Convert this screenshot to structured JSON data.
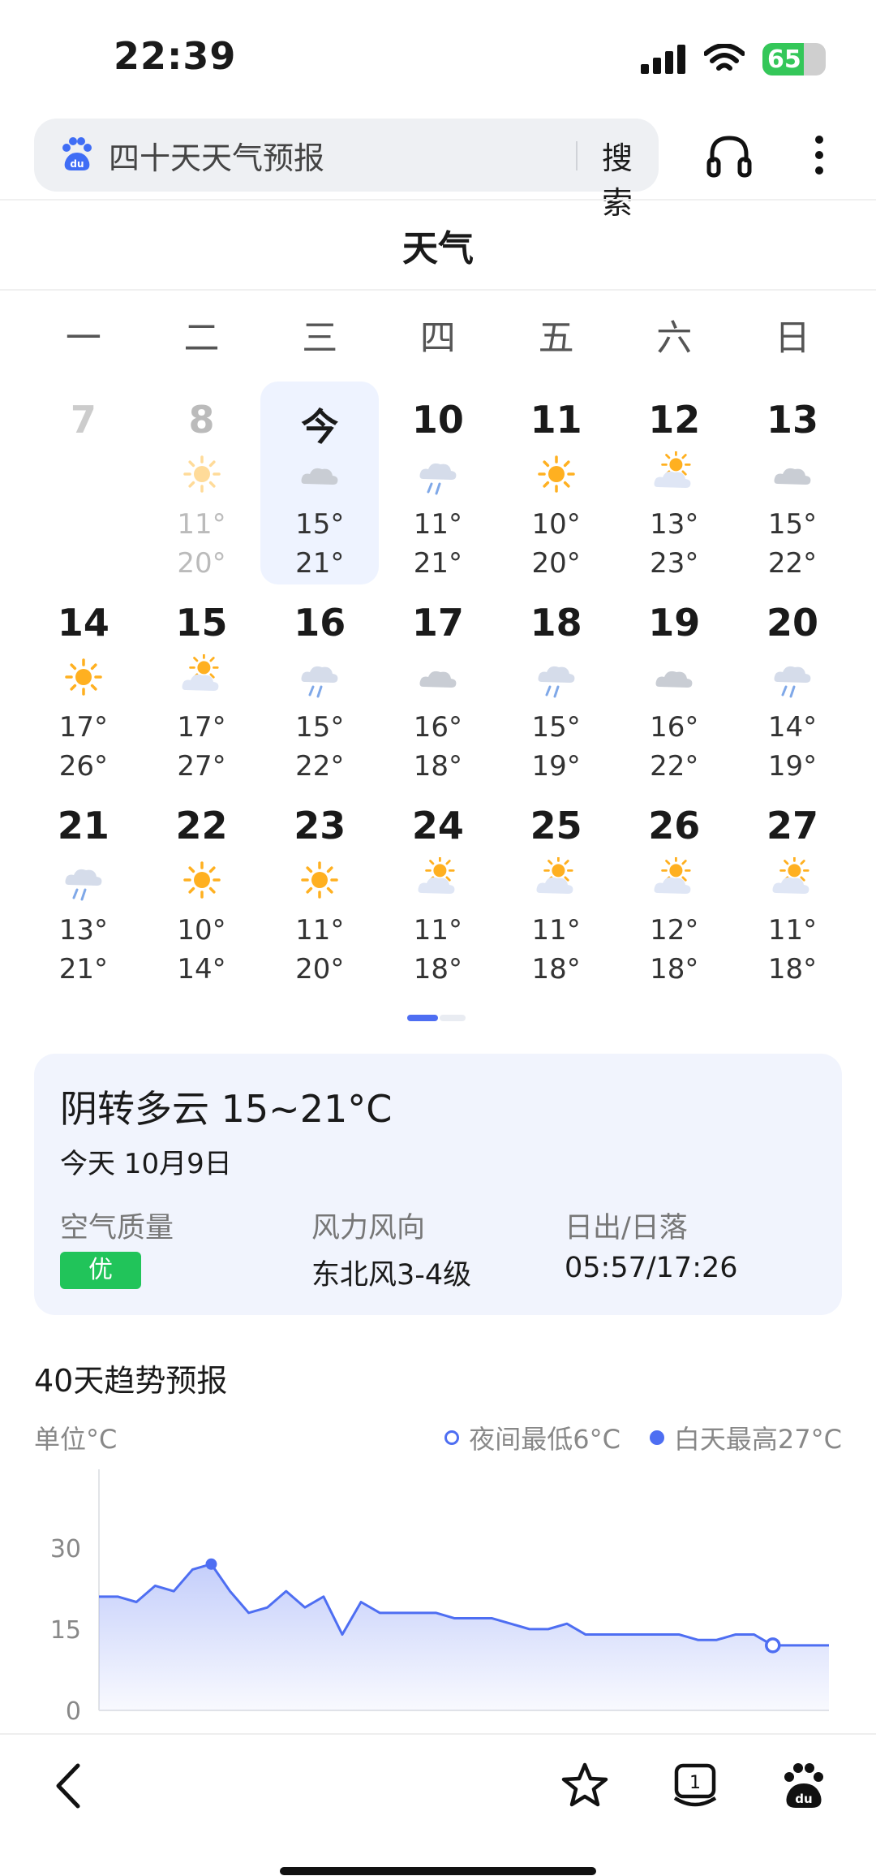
{
  "status": {
    "time": "22:39",
    "battery": "65"
  },
  "search": {
    "query": "四十天天气预报",
    "button": "搜索"
  },
  "page_title": "天气",
  "weekdays": [
    "一",
    "二",
    "三",
    "四",
    "五",
    "六",
    "日"
  ],
  "calendar": [
    {
      "day": "7",
      "icon": "",
      "low": "",
      "high": "",
      "state": "faded"
    },
    {
      "day": "8",
      "icon": "sun",
      "low": "11°",
      "high": "20°",
      "state": "past"
    },
    {
      "day": "今",
      "icon": "cloud",
      "low": "15°",
      "high": "21°",
      "state": "today"
    },
    {
      "day": "10",
      "icon": "rain",
      "low": "11°",
      "high": "21°",
      "state": ""
    },
    {
      "day": "11",
      "icon": "sun",
      "low": "10°",
      "high": "20°",
      "state": ""
    },
    {
      "day": "12",
      "icon": "partly",
      "low": "13°",
      "high": "23°",
      "state": ""
    },
    {
      "day": "13",
      "icon": "cloud",
      "low": "15°",
      "high": "22°",
      "state": ""
    },
    {
      "day": "14",
      "icon": "sun",
      "low": "17°",
      "high": "26°",
      "state": ""
    },
    {
      "day": "15",
      "icon": "partly",
      "low": "17°",
      "high": "27°",
      "state": ""
    },
    {
      "day": "16",
      "icon": "rain",
      "low": "15°",
      "high": "22°",
      "state": ""
    },
    {
      "day": "17",
      "icon": "cloud",
      "low": "16°",
      "high": "18°",
      "state": ""
    },
    {
      "day": "18",
      "icon": "rain",
      "low": "15°",
      "high": "19°",
      "state": ""
    },
    {
      "day": "19",
      "icon": "cloud",
      "low": "16°",
      "high": "22°",
      "state": ""
    },
    {
      "day": "20",
      "icon": "rain",
      "low": "14°",
      "high": "19°",
      "state": ""
    },
    {
      "day": "21",
      "icon": "rain",
      "low": "13°",
      "high": "21°",
      "state": ""
    },
    {
      "day": "22",
      "icon": "sun",
      "low": "10°",
      "high": "14°",
      "state": ""
    },
    {
      "day": "23",
      "icon": "sun",
      "low": "11°",
      "high": "20°",
      "state": ""
    },
    {
      "day": "24",
      "icon": "partly",
      "low": "11°",
      "high": "18°",
      "state": ""
    },
    {
      "day": "25",
      "icon": "partly",
      "low": "11°",
      "high": "18°",
      "state": ""
    },
    {
      "day": "26",
      "icon": "partly",
      "low": "12°",
      "high": "18°",
      "state": ""
    },
    {
      "day": "27",
      "icon": "partly",
      "low": "11°",
      "high": "18°",
      "state": ""
    }
  ],
  "today_card": {
    "title": "阴转多云 15~21°C",
    "date": "今天 10月9日",
    "aqi_label": "空气质量",
    "aqi_value": "优",
    "wind_label": "风力风向",
    "wind_value": "东北风3-4级",
    "sun_label": "日出/日落",
    "sun_value": "05:57/17:26"
  },
  "trend": {
    "title": "40天趋势预报",
    "unit": "单位°C",
    "legend_low": "夜间最低6°C",
    "legend_high": "白天最高27°C"
  },
  "colors": {
    "accent": "#4e6ef2",
    "sun": "#ffb020",
    "cloud": "#c9cdd4",
    "aqi_good": "#21c45a"
  },
  "chart_data": {
    "type": "area",
    "ylim": [
      0,
      40
    ],
    "yticks": [
      0,
      15,
      30
    ],
    "values": [
      21,
      21,
      20,
      23,
      22,
      26,
      27,
      22,
      18,
      19,
      22,
      19,
      21,
      14,
      20,
      18,
      18,
      18,
      18,
      17,
      17,
      17,
      16,
      15,
      15,
      16,
      14,
      14,
      14,
      14,
      14,
      14,
      13,
      13,
      14,
      14,
      12,
      12,
      12,
      12
    ],
    "markers": [
      {
        "index": 6,
        "style": "filled"
      },
      {
        "index": 36,
        "style": "hollow"
      }
    ]
  }
}
